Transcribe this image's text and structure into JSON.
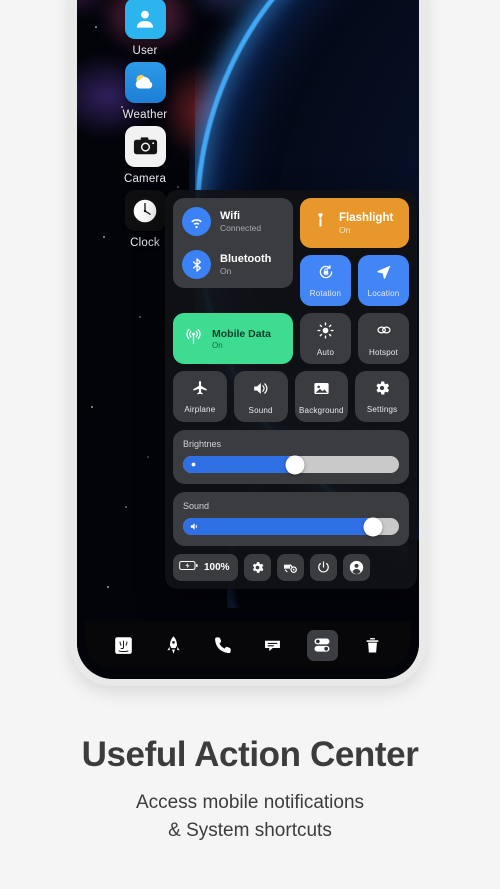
{
  "caption": {
    "title": "Useful Action Center",
    "subtitle_line1": "Access mobile notifications",
    "subtitle_line2": "& System shortcuts"
  },
  "home_apps": [
    {
      "label": "User",
      "icon": "user-icon"
    },
    {
      "label": "Weather",
      "icon": "weather-icon"
    },
    {
      "label": "Camera",
      "icon": "camera-icon"
    },
    {
      "label": "Clock",
      "icon": "clock-icon"
    }
  ],
  "control_center": {
    "connectivity": [
      {
        "title": "Wifi",
        "status": "Connected",
        "icon": "wifi-icon",
        "color": "#3b82f6"
      },
      {
        "title": "Bluetooth",
        "status": "On",
        "icon": "bluetooth-icon",
        "color": "#3b82f6"
      }
    ],
    "flashlight": {
      "title": "Flashlight",
      "status": "On",
      "icon": "flashlight-icon",
      "color": "#e8982a"
    },
    "rotation": {
      "label": "Rotation",
      "icon": "rotation-lock-icon",
      "color": "#4285f4"
    },
    "location": {
      "label": "Location",
      "icon": "location-arrow-icon",
      "color": "#4285f4"
    },
    "mobile_data": {
      "title": "Mobile Data",
      "status": "On",
      "icon": "cell-signal-icon",
      "color": "#3ddc91"
    },
    "auto": {
      "label": "Auto",
      "icon": "brightness-auto-icon"
    },
    "hotspot": {
      "label": "Hotspot",
      "icon": "hotspot-link-icon"
    },
    "airplane": {
      "label": "Airplane",
      "icon": "airplane-icon"
    },
    "sound_tile": {
      "label": "Sound",
      "icon": "speaker-icon"
    },
    "background": {
      "label": "Background",
      "icon": "image-icon"
    },
    "settings": {
      "label": "Settings",
      "icon": "gear-icon"
    },
    "brightness_slider": {
      "label": "Brightnes",
      "value": 52,
      "icon": "brightness-icon"
    },
    "sound_slider": {
      "label": "Sound",
      "value": 88,
      "icon": "volume-icon"
    },
    "actions": {
      "battery": {
        "label": "100%",
        "icon": "battery-charging-icon"
      },
      "settings_btn": {
        "icon": "gear-icon"
      },
      "tools_btn": {
        "icon": "screenshot-tools-icon"
      },
      "power_btn": {
        "icon": "power-icon"
      },
      "account_btn": {
        "icon": "account-circle-icon"
      }
    }
  },
  "dock": [
    {
      "name": "finder",
      "icon": "finder-icon",
      "active": false
    },
    {
      "name": "launchpad",
      "icon": "rocket-icon",
      "active": false
    },
    {
      "name": "phone",
      "icon": "phone-icon",
      "active": false
    },
    {
      "name": "messages",
      "icon": "message-icon",
      "active": false
    },
    {
      "name": "control-center",
      "icon": "toggles-icon",
      "active": true
    },
    {
      "name": "trash",
      "icon": "trash-icon",
      "active": false
    }
  ],
  "colors": {
    "accent_blue": "#4285f4",
    "orange": "#e8982a",
    "green": "#3ddc91",
    "panel_bg": "#101114",
    "tile_bg": "#3a3c40",
    "page_bg": "#F5F5F5"
  }
}
